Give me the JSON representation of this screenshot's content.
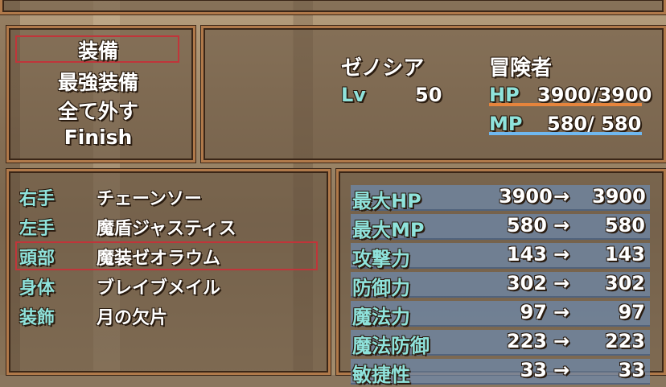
{
  "commands": [
    {
      "label": "装備",
      "selected": true
    },
    {
      "label": "最強装備",
      "selected": false
    },
    {
      "label": "全て外す",
      "selected": false
    },
    {
      "label": "Finish",
      "selected": false
    }
  ],
  "actor": {
    "name": "ゼノシア",
    "class": "冒険者",
    "level_label": "Lv",
    "level": "50",
    "hp_label": "HP",
    "hp": "3900/3900",
    "hp_fill": 1.0,
    "mp_label": "MP",
    "mp": "580/ 580",
    "mp_fill": 1.0
  },
  "slots": [
    {
      "slot": "右手",
      "item": "チェーンソー",
      "selected": false
    },
    {
      "slot": "左手",
      "item": "魔盾ジャスティス",
      "selected": false
    },
    {
      "slot": "頭部",
      "item": "魔装ゼオラウム",
      "selected": true
    },
    {
      "slot": "身体",
      "item": "ブレイブメイル",
      "selected": false
    },
    {
      "slot": "装飾",
      "item": "月の欠片",
      "selected": false
    }
  ],
  "params": [
    {
      "name": "最大HP",
      "current": "3900",
      "arrow": "→",
      "new": "3900"
    },
    {
      "name": "最大MP",
      "current": "580",
      "arrow": "→",
      "new": "580"
    },
    {
      "name": "攻撃力",
      "current": "143",
      "arrow": "→",
      "new": "143"
    },
    {
      "name": "防御力",
      "current": "302",
      "arrow": "→",
      "new": "302"
    },
    {
      "name": "魔法力",
      "current": "97",
      "arrow": "→",
      "new": "97"
    },
    {
      "name": "魔法防御",
      "current": "223",
      "arrow": "→",
      "new": "223"
    },
    {
      "name": "敏捷性",
      "current": "33",
      "arrow": "→",
      "new": "33"
    }
  ],
  "colors": {
    "frame": "#b0794a",
    "text": "#ffffff",
    "system_text": "#8fe3dc",
    "hp_gauge": "#e6843c",
    "mp_gauge": "#6fb8f0",
    "cursor": "#c0353a",
    "param_row": "#6e88aa"
  }
}
